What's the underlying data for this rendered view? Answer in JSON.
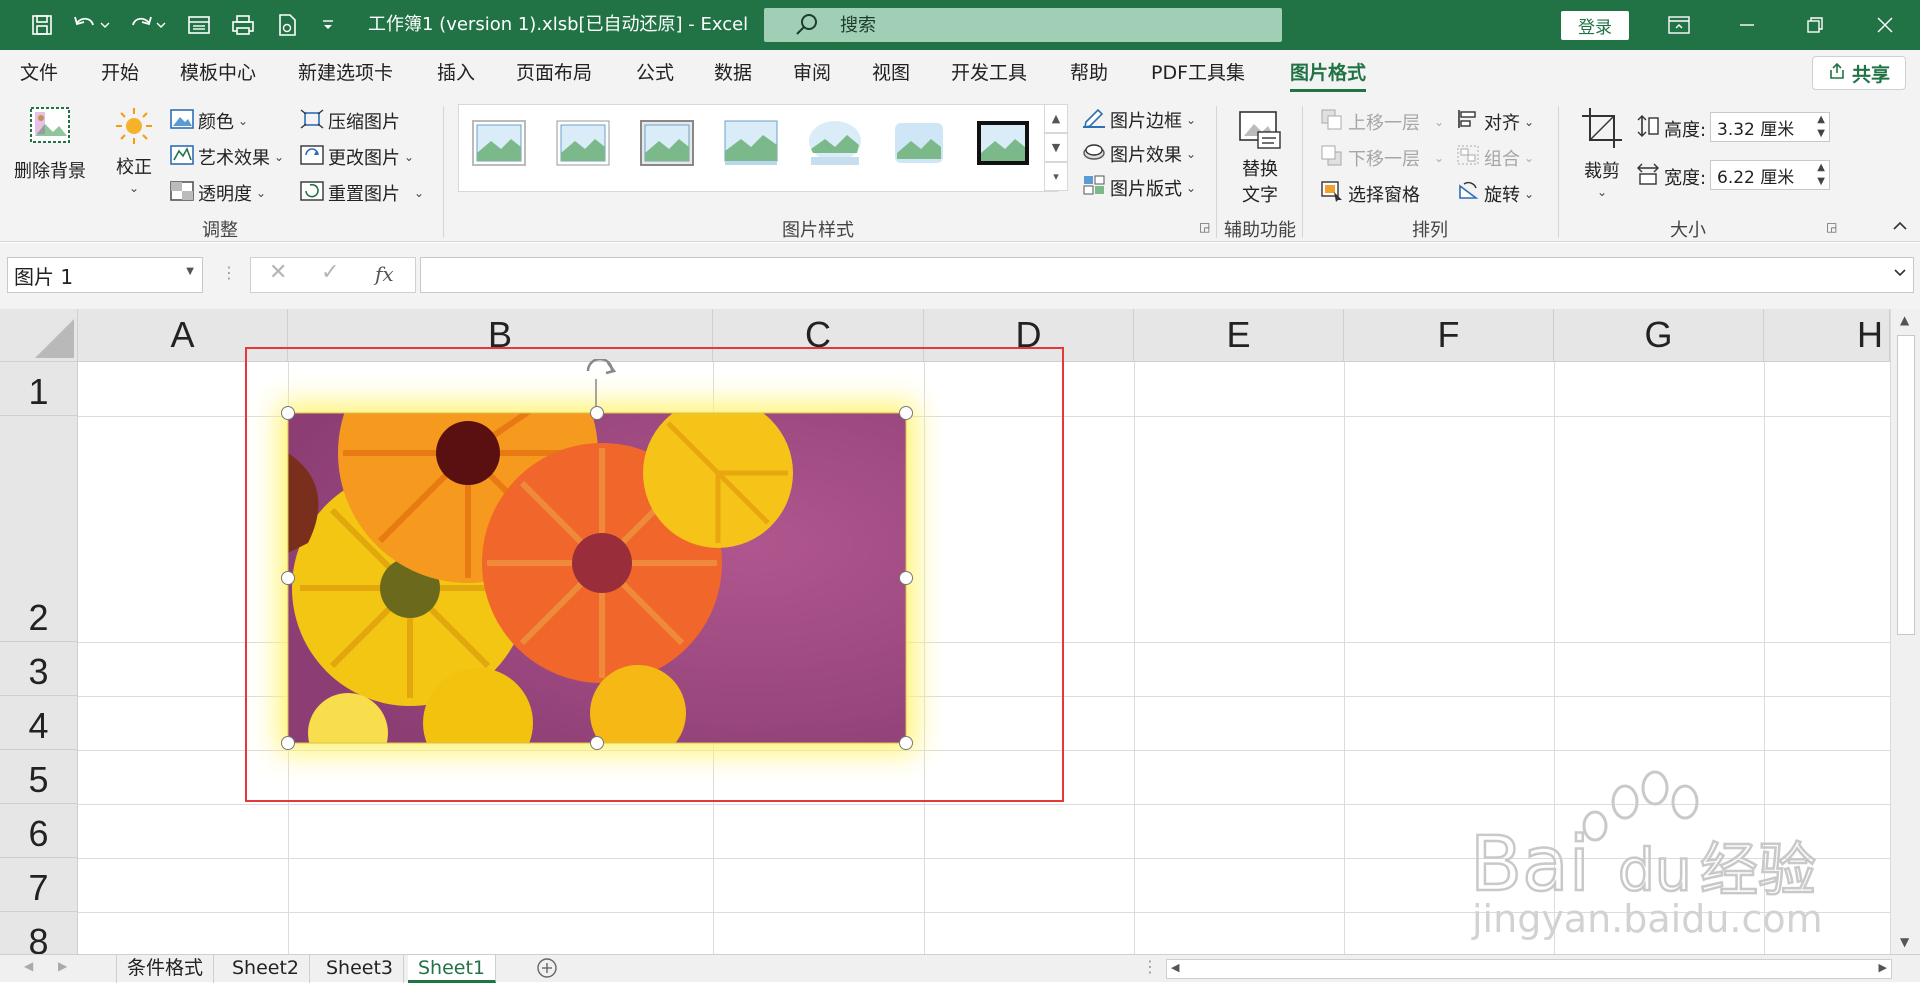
{
  "window": {
    "title": "工作簿1 (version 1).xlsb[已自动还原]  -  Excel",
    "search_placeholder": "搜索",
    "login_label": "登录",
    "accent": "#217346"
  },
  "ribbon_tabs": [
    "文件",
    "开始",
    "模板中心",
    "新建选项卡",
    "插入",
    "页面布局",
    "公式",
    "数据",
    "审阅",
    "视图",
    "开发工具",
    "帮助",
    "PDF工具集",
    "图片格式"
  ],
  "share_label": "共享",
  "ribbon": {
    "remove_bg": "删除背景",
    "correct": "校正",
    "color": "颜色",
    "art_effects": "艺术效果",
    "transparency": "透明度",
    "compress": "压缩图片",
    "change_pic": "更改图片",
    "reset_pic": "重置图片",
    "group_adjust": "调整",
    "pic_border": "图片边框",
    "pic_effects": "图片效果",
    "pic_layout": "图片版式",
    "group_styles": "图片样式",
    "alt_text_1": "替换",
    "alt_text_2": "文字",
    "group_access": "辅助功能",
    "bring_forward": "上移一层",
    "send_backward": "下移一层",
    "selection_pane": "选择窗格",
    "align": "对齐",
    "group": "组合",
    "rotate": "旋转",
    "group_arrange": "排列",
    "crop": "裁剪",
    "height_label": "高度:",
    "height_value": "3.32 厘米",
    "width_label": "宽度:",
    "width_value": "6.22 厘米",
    "group_size": "大小"
  },
  "formula_bar": {
    "name_box": "图片 1",
    "fx": "fx",
    "formula": ""
  },
  "columns": [
    "A",
    "B",
    "C",
    "D",
    "E",
    "F",
    "G",
    "H"
  ],
  "rows": [
    "1",
    "2",
    "3",
    "4",
    "5",
    "6",
    "7",
    "8"
  ],
  "sheets": [
    "条件格式",
    "Sheet2",
    "Sheet3",
    "Sheet1"
  ],
  "active_sheet": "Sheet1",
  "watermark": {
    "brand_1": "Bai",
    "brand_2": "du",
    "brand_3": "经验",
    "url": "jingyan.baidu.com"
  }
}
